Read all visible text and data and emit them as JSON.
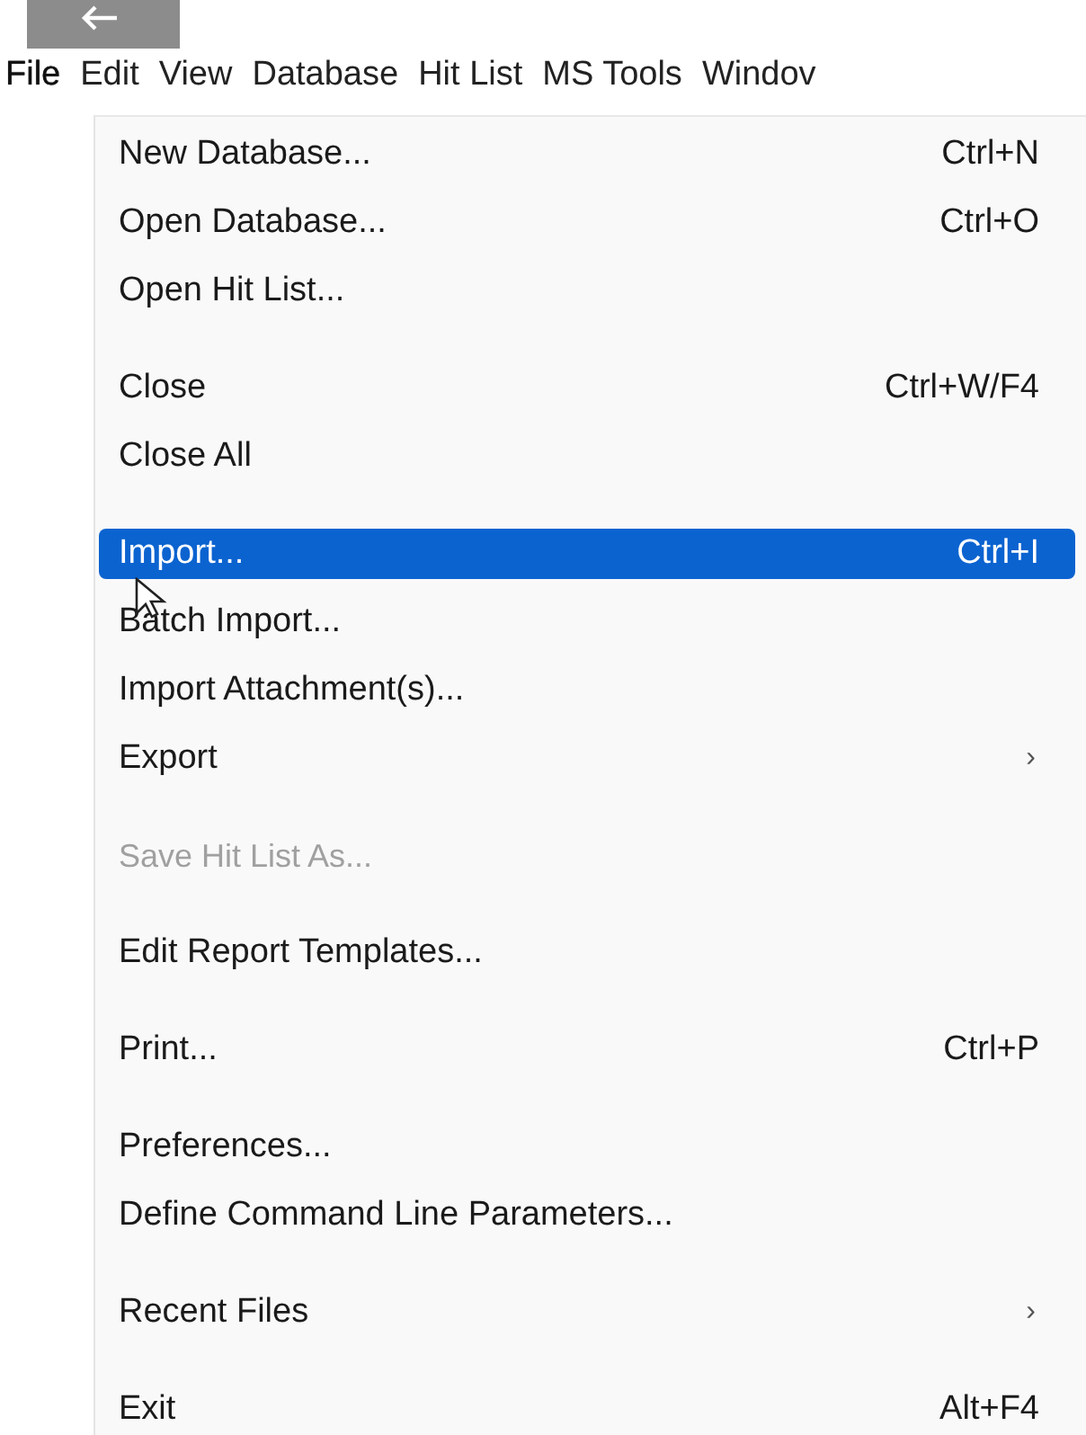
{
  "menubar": [
    {
      "label": "File",
      "selected": true
    },
    {
      "label": "Edit",
      "selected": false
    },
    {
      "label": "View",
      "selected": false
    },
    {
      "label": "Database",
      "selected": false
    },
    {
      "label": "Hit List",
      "selected": false
    },
    {
      "label": "MS Tools",
      "selected": false
    },
    {
      "label": "Windov",
      "selected": false
    }
  ],
  "menu": [
    {
      "kind": "item",
      "label": "New Database...",
      "shortcut": "Ctrl+N",
      "selected": false,
      "disabled": false
    },
    {
      "kind": "item",
      "label": "Open Database...",
      "shortcut": "Ctrl+O",
      "selected": false,
      "disabled": false
    },
    {
      "kind": "item",
      "label": "Open Hit List...",
      "selected": false,
      "disabled": false
    },
    {
      "kind": "separator"
    },
    {
      "kind": "item",
      "label": "Close",
      "shortcut": "Ctrl+W/F4",
      "selected": false,
      "disabled": false
    },
    {
      "kind": "item",
      "label": "Close All",
      "selected": false,
      "disabled": false
    },
    {
      "kind": "separator"
    },
    {
      "kind": "item",
      "label": "Import...",
      "shortcut": "Ctrl+I",
      "selected": true,
      "disabled": false
    },
    {
      "kind": "item",
      "label": "Batch Import...",
      "selected": false,
      "disabled": false
    },
    {
      "kind": "item",
      "label": "Import Attachment(s)...",
      "selected": false,
      "disabled": false
    },
    {
      "kind": "item",
      "label": "Export",
      "submenu_arrow": "›",
      "selected": false,
      "disabled": false
    },
    {
      "kind": "separator"
    },
    {
      "kind": "item",
      "label": "Save Hit List As...",
      "selected": false,
      "disabled": true
    },
    {
      "kind": "separator"
    },
    {
      "kind": "item",
      "label": "Edit Report Templates...",
      "selected": false,
      "disabled": false
    },
    {
      "kind": "separator"
    },
    {
      "kind": "item",
      "label": "Print...",
      "shortcut": "Ctrl+P",
      "selected": false,
      "disabled": false
    },
    {
      "kind": "separator"
    },
    {
      "kind": "item",
      "label": "Preferences...",
      "selected": false,
      "disabled": false
    },
    {
      "kind": "item",
      "label": "Define Command Line Parameters...",
      "selected": false,
      "disabled": false
    },
    {
      "kind": "separator"
    },
    {
      "kind": "item",
      "label": "Recent Files",
      "submenu_arrow": "›",
      "selected": false,
      "disabled": false
    },
    {
      "kind": "separator"
    },
    {
      "kind": "item",
      "label": "Exit",
      "shortcut": "Alt+F4",
      "selected": false,
      "disabled": false
    }
  ]
}
